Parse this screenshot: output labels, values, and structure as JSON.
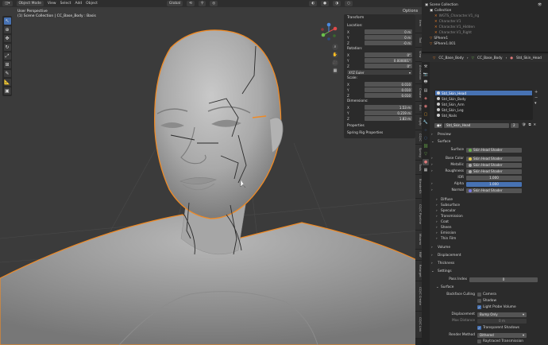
{
  "viewport": {
    "mode": "Object Mode",
    "menus": [
      "View",
      "Select",
      "Add",
      "Object"
    ],
    "orientation": "Global",
    "options": "Options",
    "info_title": "User Perspective",
    "info_sub": "(1) Scene Collection | CC_Base_Body : Basis"
  },
  "npanel": {
    "transform_label": "Transform",
    "location_label": "Location:",
    "location": [
      {
        "axis": "X",
        "value": "0 m"
      },
      {
        "axis": "Y",
        "value": "0 m"
      },
      {
        "axis": "Z",
        "value": "-0 m"
      }
    ],
    "rotation_label": "Rotation:",
    "rotation": [
      {
        "axis": "X",
        "value": "0°"
      },
      {
        "axis": "Y",
        "value": "0.000001°"
      },
      {
        "axis": "Z",
        "value": "0°"
      }
    ],
    "rotation_mode": "XYZ Euler",
    "scale_label": "Scale:",
    "scale": [
      {
        "axis": "X",
        "value": "0.010"
      },
      {
        "axis": "Y",
        "value": "0.010"
      },
      {
        "axis": "Z",
        "value": "0.010"
      }
    ],
    "dimensions_label": "Dimensions:",
    "dimensions": [
      {
        "axis": "X",
        "value": "1.53 m"
      },
      {
        "axis": "Y",
        "value": "0.219 m"
      },
      {
        "axis": "Z",
        "value": "1.83 m"
      }
    ],
    "properties_label": "Properties",
    "spring_label": "Spring Rig Properties"
  },
  "ntabs": [
    "Item",
    "Tool",
    "View",
    "Animation",
    "Create",
    "Edit",
    "Rigify",
    "CC/iC",
    "Spring",
    "Tools",
    "BlenderKit",
    "CC/iC Pipeline",
    "Mixamo",
    "RBF",
    "Retarget",
    "CC/iC Create",
    "CC/iC Link"
  ],
  "outliner": {
    "root": "Scene Collection",
    "items": [
      "Collection",
      "WGTS_Character.V1_rig",
      "Character.V1",
      "Character.V1_Hidden",
      "Character.V1_Right",
      "SPhere1",
      "SPhere1.001"
    ]
  },
  "properties": {
    "breadcrumb": [
      "CC_Base_Body",
      "CC_Base_Body",
      "Std_Skin_Head"
    ],
    "slots": [
      "Std_Skin_Head",
      "Std_Skin_Body",
      "Std_Skin_Arm",
      "Std_Skin_Leg",
      "Std_Nails"
    ],
    "material_name": "Std_Skin_Head",
    "user_count": "2",
    "preview_label": "Preview",
    "surface_label": "Surface",
    "surface_field": "Skin Head Shader",
    "inputs": [
      {
        "label": "Surface",
        "value": "Skin Head Shader"
      },
      {
        "label": "Base Color",
        "value": "Skin Head Shader"
      },
      {
        "label": "Metallic",
        "value": "Skin Head Shader"
      },
      {
        "label": "Roughness",
        "value": "Skin Head Shader"
      },
      {
        "label": "IOR",
        "value": "1.000"
      },
      {
        "label": "Alpha",
        "value": "1.000"
      },
      {
        "label": "Normal",
        "value": "Skin Head Shader"
      }
    ],
    "subpanels": [
      "Diffuse",
      "Subsurface",
      "Specular",
      "Transmission",
      "Coat",
      "Sheen",
      "Emission",
      "Thin Film"
    ],
    "volume_label": "Volume",
    "displacement_label": "Displacement",
    "thickness_label": "Thickness",
    "settings_label": "Settings",
    "pass_index_label": "Pass Index",
    "pass_index": "0",
    "surface2_label": "Surface",
    "backface_label": "Backface Culling",
    "camera_label": "Camera",
    "shadow_label": "Shadow",
    "light_probe_label": "Light Probe Volume",
    "disp_label": "Displacement",
    "disp_value": "Bump Only",
    "max_disp_label": "Max Distance",
    "max_disp_value": "0 m",
    "transparent_shadows": "Transparent Shadows",
    "render_method_label": "Render Method",
    "render_method": "Dithered",
    "raytraced": "Raytraced Transmission"
  }
}
